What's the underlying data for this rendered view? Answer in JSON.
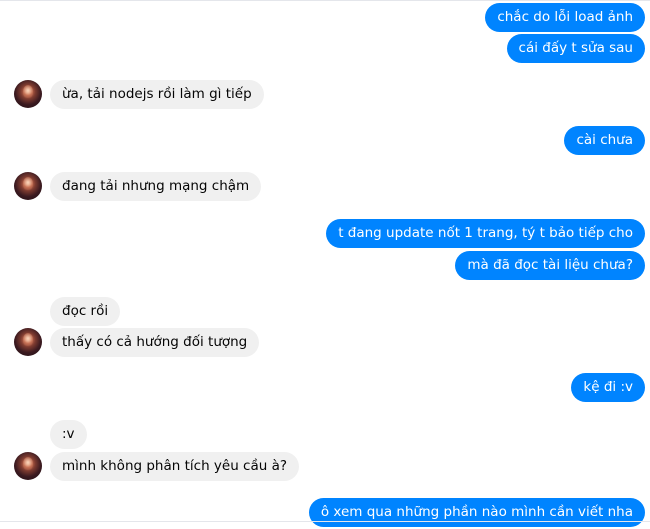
{
  "conversation": {
    "messages": [
      {
        "direction": "out",
        "text": "chắc do lỗi load ảnh"
      },
      {
        "direction": "out",
        "text": "cái đấy t sửa sau"
      },
      {
        "direction": "in",
        "text": "ừa, tải nodejs rồi làm gì tiếp",
        "avatar": "contact-avatar"
      },
      {
        "direction": "out",
        "text": "cài chưa"
      },
      {
        "direction": "in",
        "text": "đang tải nhưng mạng chậm",
        "avatar": "contact-avatar"
      },
      {
        "direction": "out",
        "text": "t đang update nốt 1 trang, tý t bảo tiếp cho"
      },
      {
        "direction": "out",
        "text": "mà đã đọc tài liệu chưa?"
      },
      {
        "direction": "in",
        "text": "đọc rồi"
      },
      {
        "direction": "in",
        "text": "thấy có cả hướng đối tượng",
        "avatar": "contact-avatar"
      },
      {
        "direction": "out",
        "text": "kệ đi :v"
      },
      {
        "direction": "in",
        "text": ":v"
      },
      {
        "direction": "in",
        "text": "mình không phân tích yêu cầu à?",
        "avatar": "contact-avatar"
      },
      {
        "direction": "out",
        "text": "ô xem qua những phần nào mình cần viết nha"
      }
    ]
  },
  "colors": {
    "outgoing_bubble": "#0084ff",
    "outgoing_text": "#ffffff",
    "incoming_bubble": "#f0f0f0",
    "incoming_text": "#050505"
  }
}
